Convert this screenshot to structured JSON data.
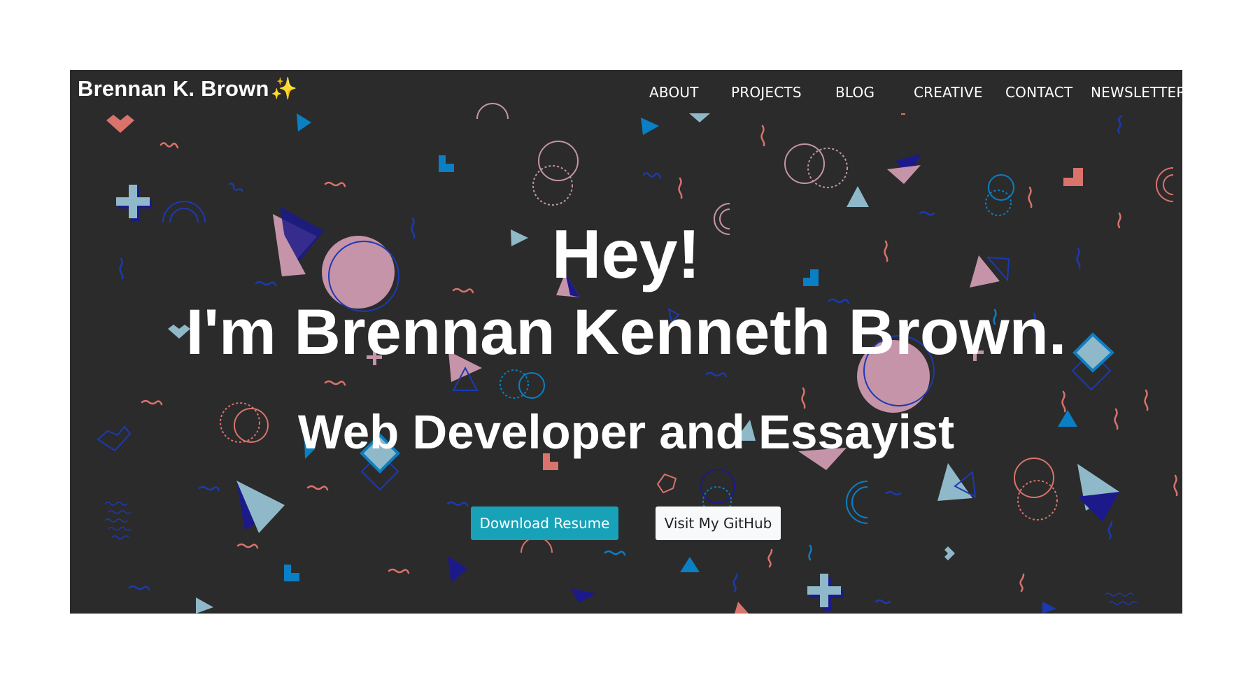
{
  "navbar": {
    "brand": "Brennan K. Brown",
    "brand_emoji": "✨",
    "links": [
      "ABOUT",
      "PROJECTS",
      "BLOG",
      "CREATIVE",
      "CONTACT",
      "NEWSLETTER"
    ]
  },
  "hero": {
    "greeting": "Hey!",
    "name_line": "I'm Brennan Kenneth Brown.",
    "subtitle": "Web Developer and Essayist"
  },
  "buttons": {
    "resume": "Download Resume",
    "github": "Visit My GitHub"
  },
  "colors": {
    "background": "#2b2b2b",
    "accent_button": "#17a2b8",
    "pattern_pink": "#c594a8",
    "pattern_salmon": "#d9736c",
    "pattern_navy": "#1c1a8a",
    "pattern_blue": "#0a7fc4",
    "pattern_light_blue": "#8fb9c9"
  }
}
